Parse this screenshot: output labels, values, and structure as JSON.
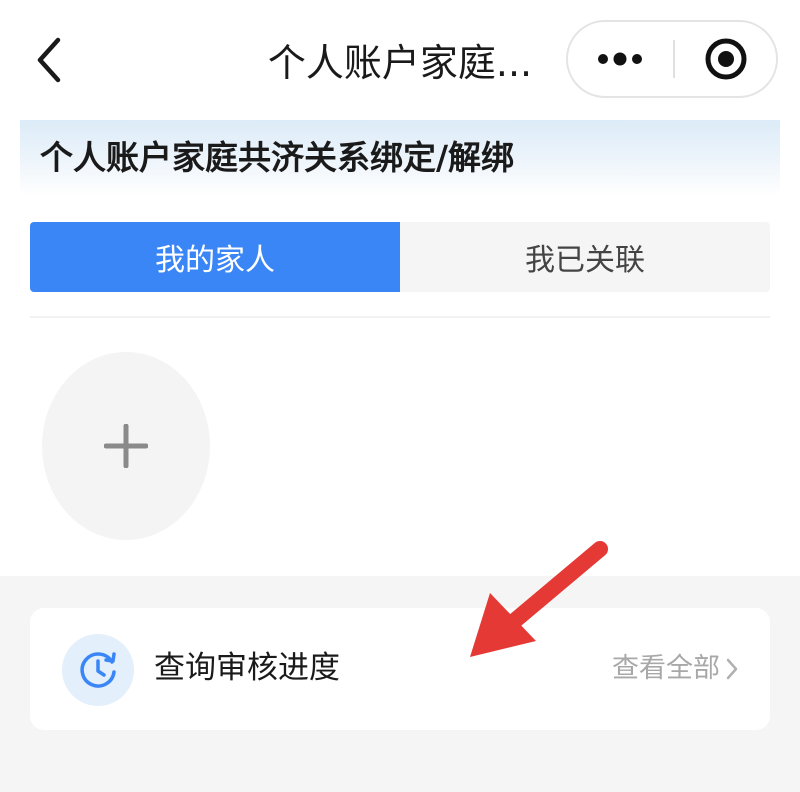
{
  "nav": {
    "title": "个人账户家庭...",
    "back_icon": "chevron-left-icon",
    "more_icon": "more-dots-icon",
    "close_icon": "target-circle-icon"
  },
  "banner": {
    "title": "个人账户家庭共济关系绑定/解绑"
  },
  "tabs": [
    {
      "label": "我的家人",
      "active": true
    },
    {
      "label": "我已关联",
      "active": false
    }
  ],
  "add_member": {
    "icon": "plus-icon"
  },
  "progress_card": {
    "icon": "clock-refresh-icon",
    "label": "查询审核进度",
    "view_all": "查看全部"
  },
  "colors": {
    "accent": "#3b86f7",
    "banner_bg": "#dcebf8",
    "annotation_arrow": "#e53935"
  }
}
